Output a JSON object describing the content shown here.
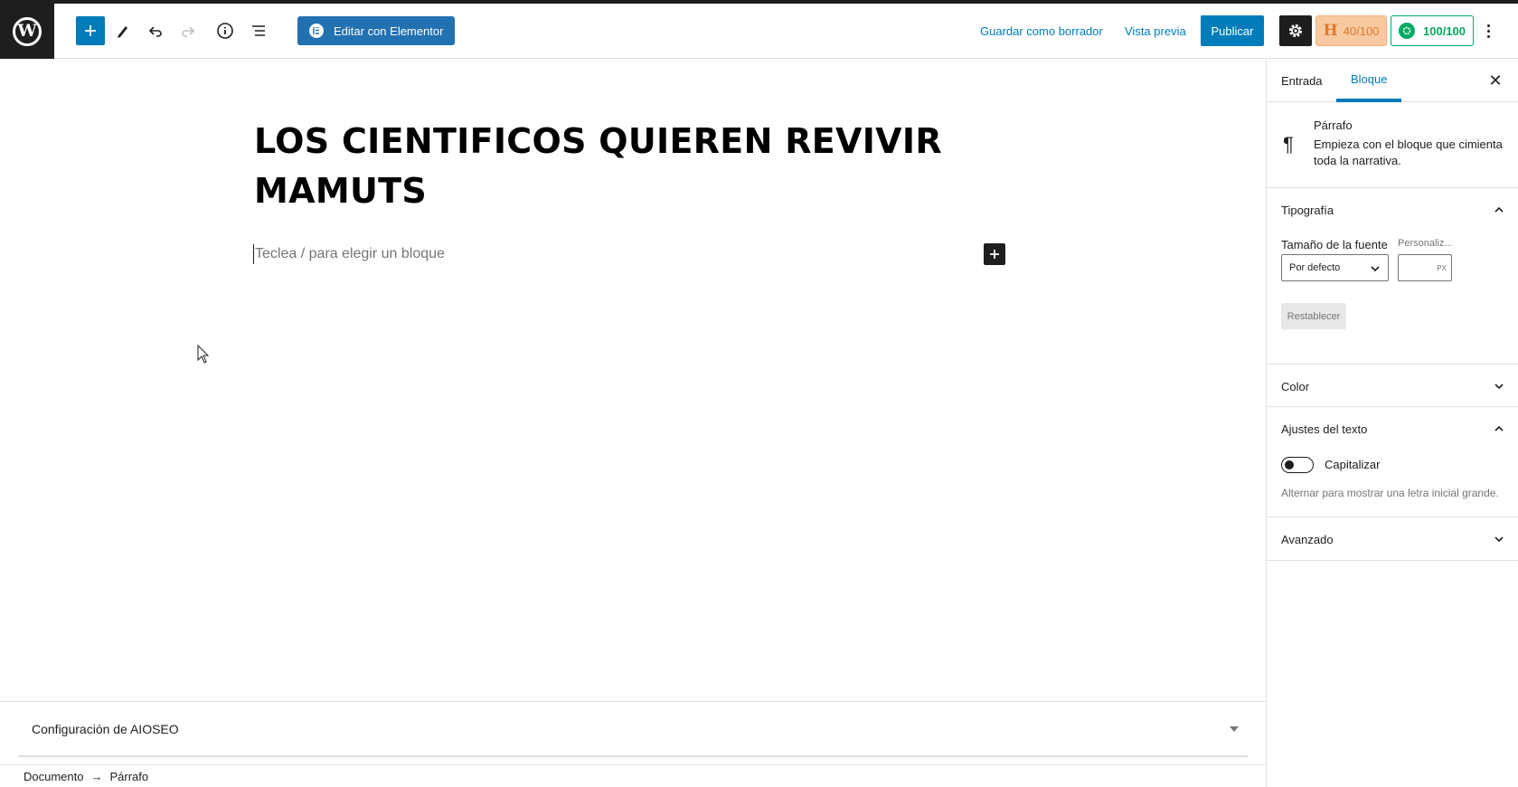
{
  "toolbar": {
    "wp_logo": "W",
    "elementor_label": "Editar con Elementor",
    "save_draft_label": "Guardar como borrador",
    "preview_label": "Vista previa",
    "publish_label": "Publicar",
    "headline_score": "40/100",
    "seo_score": "100/100",
    "icons": [
      "plus-icon",
      "pencil-icon",
      "undo-icon",
      "redo-icon",
      "info-icon",
      "list-view-icon",
      "gear-icon",
      "more-vertical-icon"
    ]
  },
  "editor": {
    "title": "LOS CIENTIFICOS QUIEREN REVIVIR MAMUTS",
    "paragraph_placeholder": "Teclea / para elegir un bloque"
  },
  "aioseo": {
    "label": "Configuración de AIOSEO"
  },
  "breadcrumb": {
    "items": [
      "Documento",
      "Párrafo"
    ],
    "separator": "→"
  },
  "sidebar": {
    "tabs": [
      "Entrada",
      "Bloque"
    ],
    "active_tab": "Bloque",
    "close_label": "✕",
    "block": {
      "name": "Párrafo",
      "description": "Empieza con el bloque que cimienta toda la narrativa."
    },
    "typography": {
      "title": "Tipografía",
      "font_size_label": "Tamaño de la fuente",
      "custom_label": "Personaliz...",
      "select_value": "Por defecto",
      "unit": "PX",
      "reset_label": "Restablecer"
    },
    "color": {
      "title": "Color"
    },
    "text_settings": {
      "title": "Ajustes del texto",
      "toggle_label": "Capitalizar",
      "help": "Alternar para mostrar una letra inicial grande."
    },
    "advanced": {
      "title": "Avanzado"
    }
  },
  "colors": {
    "accent": "#007cba",
    "dark": "#1e1e1e",
    "headline_orange": "#e07b2c",
    "seo_green": "#00aa63"
  }
}
